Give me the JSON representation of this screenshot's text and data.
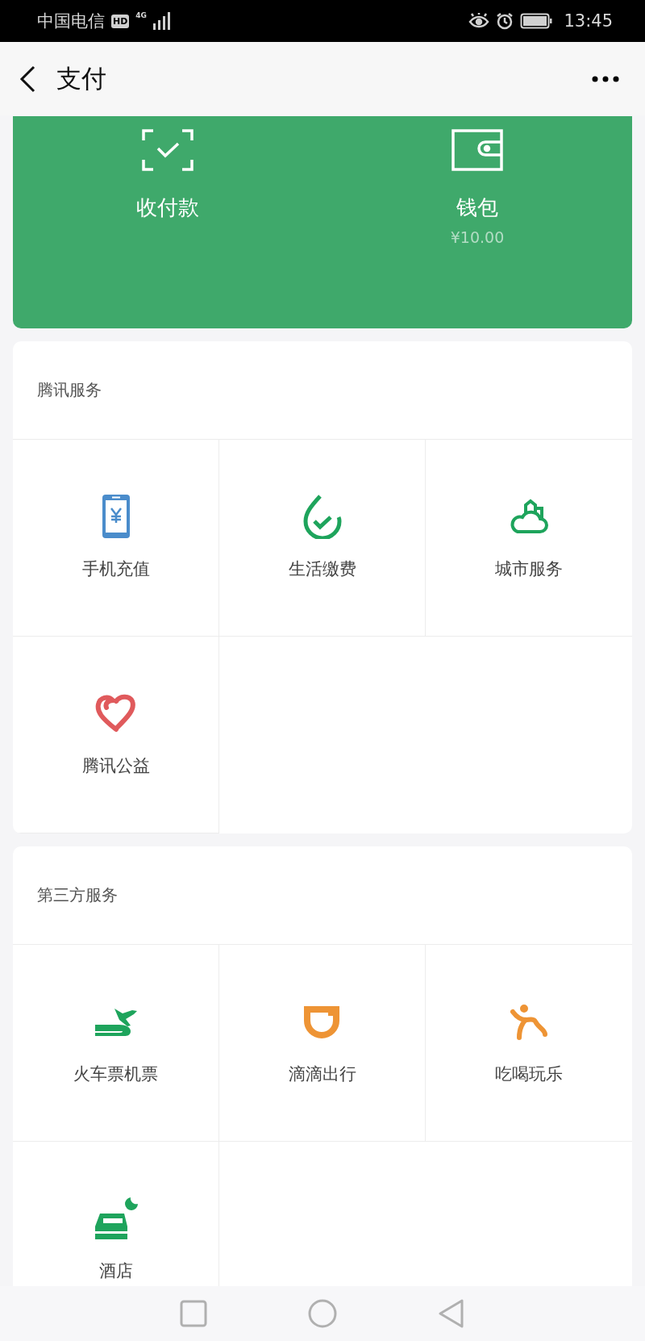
{
  "status_bar": {
    "carrier": "中国电信",
    "hd": "HD",
    "network": "4G",
    "time": "13:45"
  },
  "nav": {
    "title": "支付"
  },
  "wallet_card": {
    "items": [
      {
        "label": "收付款"
      },
      {
        "label": "钱包",
        "amount": "¥10.00"
      }
    ]
  },
  "sections": [
    {
      "title": "腾讯服务",
      "items": [
        {
          "label": "手机充值"
        },
        {
          "label": "生活缴费"
        },
        {
          "label": "城市服务"
        },
        {
          "label": "腾讯公益"
        }
      ]
    },
    {
      "title": "第三方服务",
      "items": [
        {
          "label": "火车票机票"
        },
        {
          "label": "滴滴出行"
        },
        {
          "label": "吃喝玩乐"
        },
        {
          "label": "酒店"
        }
      ]
    }
  ]
}
